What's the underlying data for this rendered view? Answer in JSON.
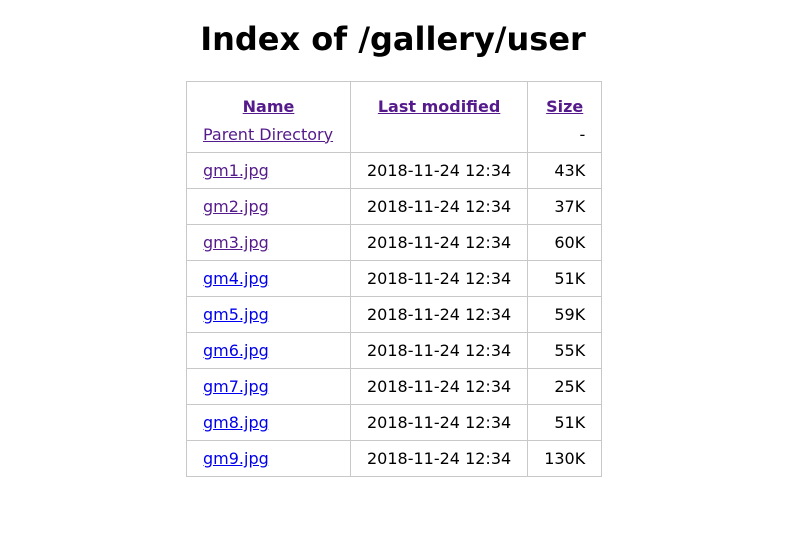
{
  "page": {
    "title": "Index of /gallery/user"
  },
  "columns": {
    "name": "Name",
    "last_modified": "Last modified",
    "size": "Size"
  },
  "parent": {
    "label": "Parent Directory",
    "size": "-"
  },
  "files": [
    {
      "name": "gm1.jpg",
      "modified": "2018-11-24 12:34",
      "size": "43K",
      "visited": true
    },
    {
      "name": "gm2.jpg",
      "modified": "2018-11-24 12:34",
      "size": "37K",
      "visited": true
    },
    {
      "name": "gm3.jpg",
      "modified": "2018-11-24 12:34",
      "size": "60K",
      "visited": true
    },
    {
      "name": "gm4.jpg",
      "modified": "2018-11-24 12:34",
      "size": "51K",
      "visited": false
    },
    {
      "name": "gm5.jpg",
      "modified": "2018-11-24 12:34",
      "size": "59K",
      "visited": false
    },
    {
      "name": "gm6.jpg",
      "modified": "2018-11-24 12:34",
      "size": "55K",
      "visited": false
    },
    {
      "name": "gm7.jpg",
      "modified": "2018-11-24 12:34",
      "size": "25K",
      "visited": false
    },
    {
      "name": "gm8.jpg",
      "modified": "2018-11-24 12:34",
      "size": "51K",
      "visited": false
    },
    {
      "name": "gm9.jpg",
      "modified": "2018-11-24 12:34",
      "size": "130K",
      "visited": false
    }
  ],
  "colors": {
    "visited_link": "#551a8b",
    "unvisited_link": "#0000ee",
    "border": "#c8c8c8"
  }
}
